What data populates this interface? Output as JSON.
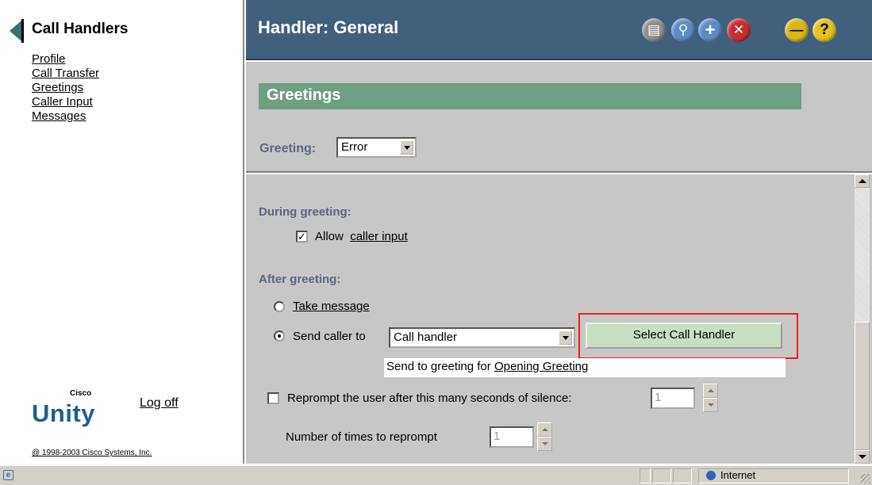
{
  "sidebar": {
    "title": "Call Handlers",
    "nav": [
      "Profile",
      "Call Transfer",
      "Greetings",
      "Caller Input",
      "Messages"
    ],
    "brand_small": "Cisco",
    "brand_big": "Unity",
    "logoff": "Log off",
    "copyright": "@ 1998-2003 Cisco Systems, Inc."
  },
  "header": {
    "title": "Handler: General",
    "tools": [
      "print-icon",
      "find-icon",
      "add-icon",
      "delete-icon",
      "minimize-icon",
      "help-icon"
    ]
  },
  "section": {
    "title": "Greetings",
    "greeting_label": "Greeting:",
    "greeting_value": "Error"
  },
  "during": {
    "label": "During greeting:",
    "allow_text": "Allow",
    "allow_link": "caller input",
    "allow_checked": true
  },
  "after": {
    "label": "After greeting:",
    "take_message": "Take message",
    "send_caller": "Send caller to",
    "send_value": "Call handler",
    "select_button": "Select Call Handler",
    "sendto_text": "Send to greeting for",
    "sendto_link": "Opening Greeting"
  },
  "reprompt": {
    "label": "Reprompt the user after this many seconds of silence:",
    "seconds": "1",
    "times_label": "Number of times to reprompt",
    "times": "1"
  },
  "statusbar": {
    "zone": "Internet"
  },
  "colors": {
    "header_bg": "#41607e",
    "section_bar": "#6e9e84",
    "highlight": "#ee1c1c"
  }
}
